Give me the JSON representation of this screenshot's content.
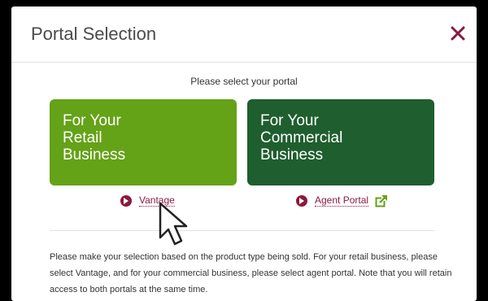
{
  "modal": {
    "title": "Portal Selection",
    "close_icon": "close-icon",
    "accent_color": "#8a1a3c"
  },
  "prompt": "Please select your portal",
  "cards": {
    "retail": {
      "lines": [
        "For Your",
        "Retail",
        "Business"
      ],
      "color": "#64a217"
    },
    "commercial": {
      "lines": [
        "For Your",
        "Commercial",
        "Business"
      ],
      "color": "#1f5e2e"
    }
  },
  "links": {
    "vantage": "Vantage",
    "agent_portal": "Agent Portal",
    "external_icon": "external-link-icon"
  },
  "note": "Please make your selection based on the product type being sold. For your retail business, please select Vantage, and for your commercial business, please select agent portal. Note that you will retain access to both portals at the same time."
}
